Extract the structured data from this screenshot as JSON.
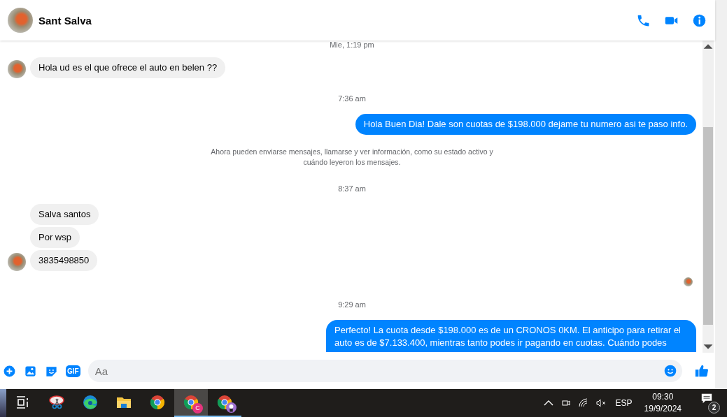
{
  "header": {
    "name": "Sant Salva"
  },
  "messages": [
    {
      "kind": "time",
      "text": "Mie, 1:19 pm"
    },
    {
      "kind": "incoming",
      "text": "Hola ud es el que ofrece el auto en belen ??",
      "avatar": true
    },
    {
      "kind": "time",
      "text": "7:36 am"
    },
    {
      "kind": "outgoing",
      "text": "Hola Buen Dia! Dale son cuotas de $198.000 dejame tu numero asi te paso info.",
      "cut": false
    },
    {
      "kind": "system",
      "text": "Ahora pueden enviarse mensajes, llamarse y ver información, como su estado activo y cuándo leyeron los mensajes."
    },
    {
      "kind": "time",
      "text": "8:37 am"
    },
    {
      "kind": "incoming",
      "text": "Salva santos",
      "avatar": false
    },
    {
      "kind": "incoming",
      "text": "Por wsp",
      "avatar": false
    },
    {
      "kind": "incoming",
      "text": "3835498850",
      "avatar": true
    },
    {
      "kind": "seen"
    },
    {
      "kind": "time",
      "text": "9:29 am"
    },
    {
      "kind": "outgoing",
      "text": "Perfecto! La cuota desde $198.000 es de un CRONOS 0KM. El anticipo para retirar el auto es de $7.133.400, mientras tanto podes ir pagando en cuotas. Cuándo podes",
      "cut": true
    }
  ],
  "composer": {
    "gif_label": "GIF",
    "placeholder": "Aa"
  },
  "taskbar": {
    "apps": [
      {
        "kind": "taskview",
        "selected": false,
        "running": false
      },
      {
        "kind": "snip",
        "selected": false,
        "running": false
      },
      {
        "kind": "edge",
        "selected": false,
        "running": false
      },
      {
        "kind": "folder",
        "selected": false,
        "running": false
      },
      {
        "kind": "chrome",
        "selected": false,
        "running": false
      },
      {
        "kind": "chrome-profile",
        "badge": "C",
        "selected": true,
        "running": true
      },
      {
        "kind": "chrome-avatar",
        "selected": false,
        "running": true
      }
    ],
    "language": "ESP",
    "time": "09:30",
    "date": "19/9/2024",
    "notifications": "2"
  }
}
